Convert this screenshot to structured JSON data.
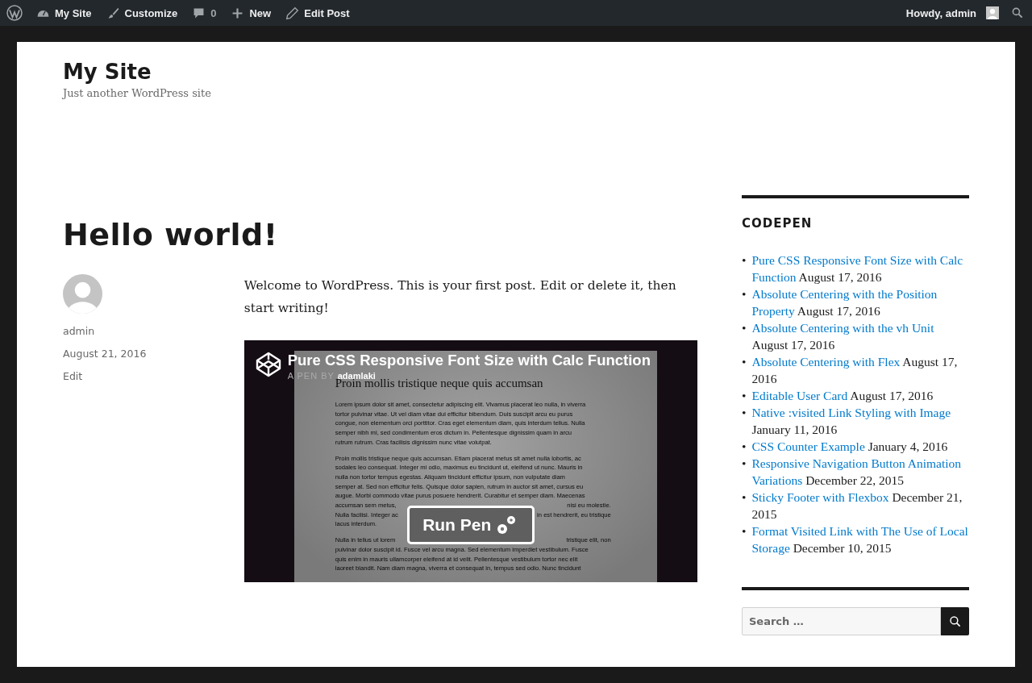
{
  "admin_bar": {
    "items": [
      {
        "kind": "site",
        "label": "My Site"
      },
      {
        "kind": "customize",
        "label": "Customize"
      },
      {
        "kind": "comments",
        "label": "0"
      },
      {
        "kind": "new",
        "label": "New"
      },
      {
        "kind": "edit",
        "label": "Edit Post"
      }
    ],
    "greeting": "Howdy, admin"
  },
  "site": {
    "title": "My Site",
    "tagline": "Just another WordPress site"
  },
  "post": {
    "title": "Hello world!",
    "author": "admin",
    "date": "August 21, 2016",
    "edit": "Edit",
    "content": "Welcome to WordPress. This is your first post. Edit or delete it, then start writing!",
    "embed": {
      "title": "Pure CSS Responsive Font Size with Calc Function",
      "byline": "A PEN BY",
      "author": "adamlaki",
      "button": "Run Pen",
      "preview": {
        "heading": "Proin mollis tristique neque quis accumsan",
        "paragraphs": [
          [
            [
              "Lorem ipsum dolor sit amet, consectetur adipiscing elit. Vivamus placerat leo nulla, in viverra"
            ],
            [
              "tortor pulvinar vitae. Ut vel diam vitae dui efficitur bibendum. Duis suscipit arcu eu purus"
            ],
            [
              "congue, non elementum orci porttitor. Cras eget elementum diam, quis interdum tellus. Nulla"
            ],
            [
              "semper nibh mi, sed condimentum eros dictum in. Pellentesque dignissim quam in arcu"
            ],
            [
              "rutrum rutrum. Cras facilisis dignissim nunc vitae volutpat."
            ]
          ],
          [
            [
              "Proin mollis tristique neque quis accumsan. Etiam placerat metus sit amet nulla lobortis, ac"
            ],
            [
              "sodales leo consequat. Integer mi odio, maximus eu tincidunt ut, eleifend ut nunc. Mauris in"
            ],
            [
              "nulla non tortor tempus egestas. Aliquam tincidunt efficitur ipsum, non vulputate diam"
            ],
            [
              "semper at. Sed non efficitur felis. Quisque dolor sapien, rutrum in auctor sit amet, cursus eu"
            ],
            [
              "augue. Morbi commodo vitae purus posuere hendrerit. Curabitur et semper diam. Maecenas"
            ],
            [
              "accumsan sem metus,",
              "nisi eu molestie."
            ],
            [
              "Nulla facilisi. Integer ac",
              "in est hendrerit, eu tristique"
            ],
            [
              "lacus interdum."
            ]
          ],
          [
            [
              "Nulla in tellus ut lorem",
              "tristique elit, non"
            ],
            [
              "pulvinar dolor suscipit id. Fusce vel arcu magna. Sed elementum imperdiet vestibulum. Fusce"
            ],
            [
              "quis enim in mauris ullamcorper eleifend at id velit. Pellentesque vestibulum tortor nec elit"
            ],
            [
              "laoreet blandit. Nam diam magna, viverra et consequat in, tempus sed odio. Nunc tincidunt"
            ]
          ]
        ]
      }
    }
  },
  "sidebar": {
    "widget_title": "CODEPEN",
    "marker": "•",
    "items": [
      {
        "link": "Pure CSS Responsive Font Size with Calc Function",
        "date": "August 17, 2016"
      },
      {
        "link": "Absolute Centering with the Position Property",
        "date": "August 17, 2016"
      },
      {
        "link": "Absolute Centering with the vh Unit",
        "date": "August 17, 2016"
      },
      {
        "link": "Absolute Centering with Flex",
        "date": "August 17, 2016"
      },
      {
        "link": "Editable User Card",
        "date": "August 17, 2016"
      },
      {
        "link": "Native :visited Link Styling with Image",
        "date": "January 11, 2016"
      },
      {
        "link": "CSS Counter Example",
        "date": "January 4, 2016"
      },
      {
        "link": "Responsive Navigation Button Animation Variations",
        "date": "December 22, 2015"
      },
      {
        "link": "Sticky Footer with Flexbox",
        "date": "December 21, 2015"
      },
      {
        "link": "Format Visited Link with The Use of Local Storage",
        "date": "December 10, 2015"
      }
    ],
    "search": {
      "placeholder": "Search …"
    }
  }
}
